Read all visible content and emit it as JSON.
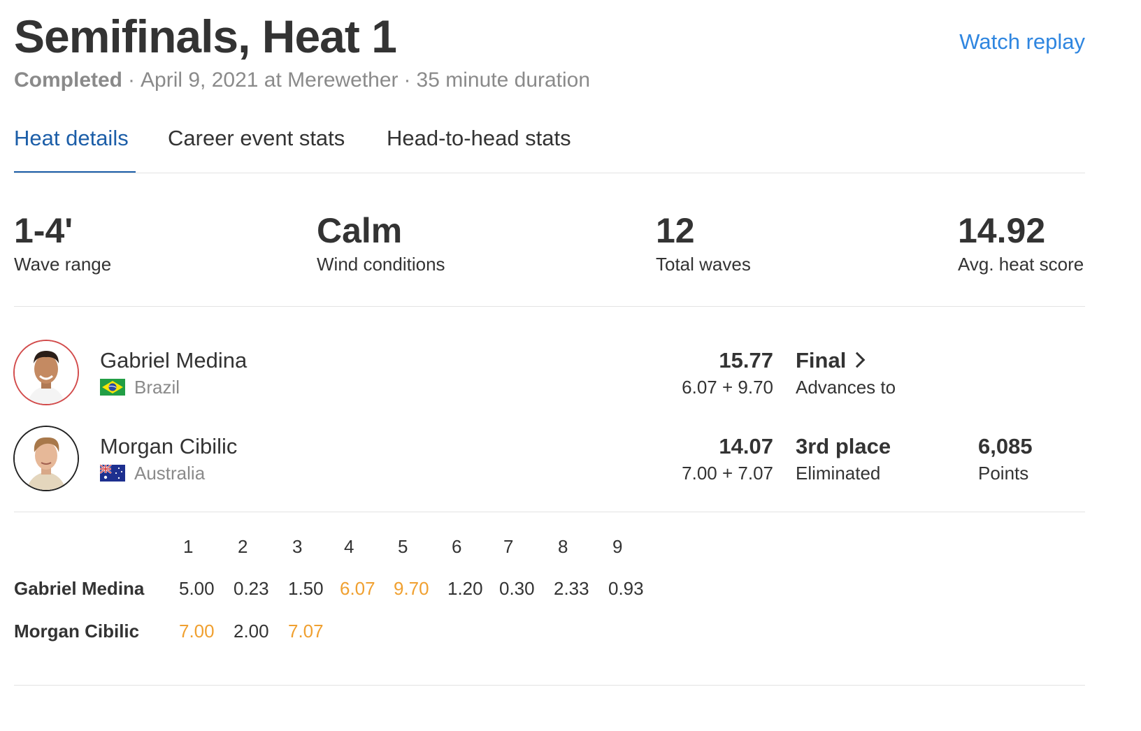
{
  "header": {
    "title": "Semifinals, Heat 1",
    "replay_label": "Watch replay",
    "status": "Completed",
    "separator": "·",
    "date_location": "April 9, 2021 at Merewether",
    "duration": "35 minute duration"
  },
  "tabs": [
    {
      "label": "Heat details",
      "active": true
    },
    {
      "label": "Career event stats",
      "active": false
    },
    {
      "label": "Head-to-head stats",
      "active": false
    }
  ],
  "stats": [
    {
      "value": "1-4'",
      "label": "Wave range"
    },
    {
      "value": "Calm",
      "label": "Wind conditions"
    },
    {
      "value": "12",
      "label": "Total waves"
    },
    {
      "value": "14.92",
      "label": "Avg. heat score"
    }
  ],
  "athletes": [
    {
      "name": "Gabriel Medina",
      "country": "Brazil",
      "flag_icon": "brazil-flag-icon",
      "total": "15.77",
      "breakdown": "6.07 + 9.70",
      "result": "Final",
      "result_sub": "Advances to",
      "ring_color": "#d24b4b"
    },
    {
      "name": "Morgan Cibilic",
      "country": "Australia",
      "flag_icon": "australia-flag-icon",
      "total": "14.07",
      "breakdown": "7.00 + 7.07",
      "result": "3rd place",
      "result_sub": "Eliminated",
      "points": "6,085",
      "points_label": "Points",
      "ring_color": "#222222"
    }
  ],
  "waves": {
    "numbers": [
      "1",
      "2",
      "3",
      "4",
      "5",
      "6",
      "7",
      "8",
      "9"
    ],
    "rows": [
      {
        "name": "Gabriel Medina",
        "scores": [
          "5.00",
          "0.23",
          "1.50",
          "6.07",
          "9.70",
          "1.20",
          "0.30",
          "2.33",
          "0.93"
        ]
      },
      {
        "name": "Morgan Cibilic",
        "scores": [
          "7.00",
          "2.00",
          "7.07"
        ]
      }
    ],
    "highlight_color": "#f0a030"
  },
  "colors": {
    "accent": "#1c5ea8",
    "link": "#2f86e0",
    "highlight": "#f0a030",
    "text": "#333333",
    "muted": "#8a8a8a"
  }
}
